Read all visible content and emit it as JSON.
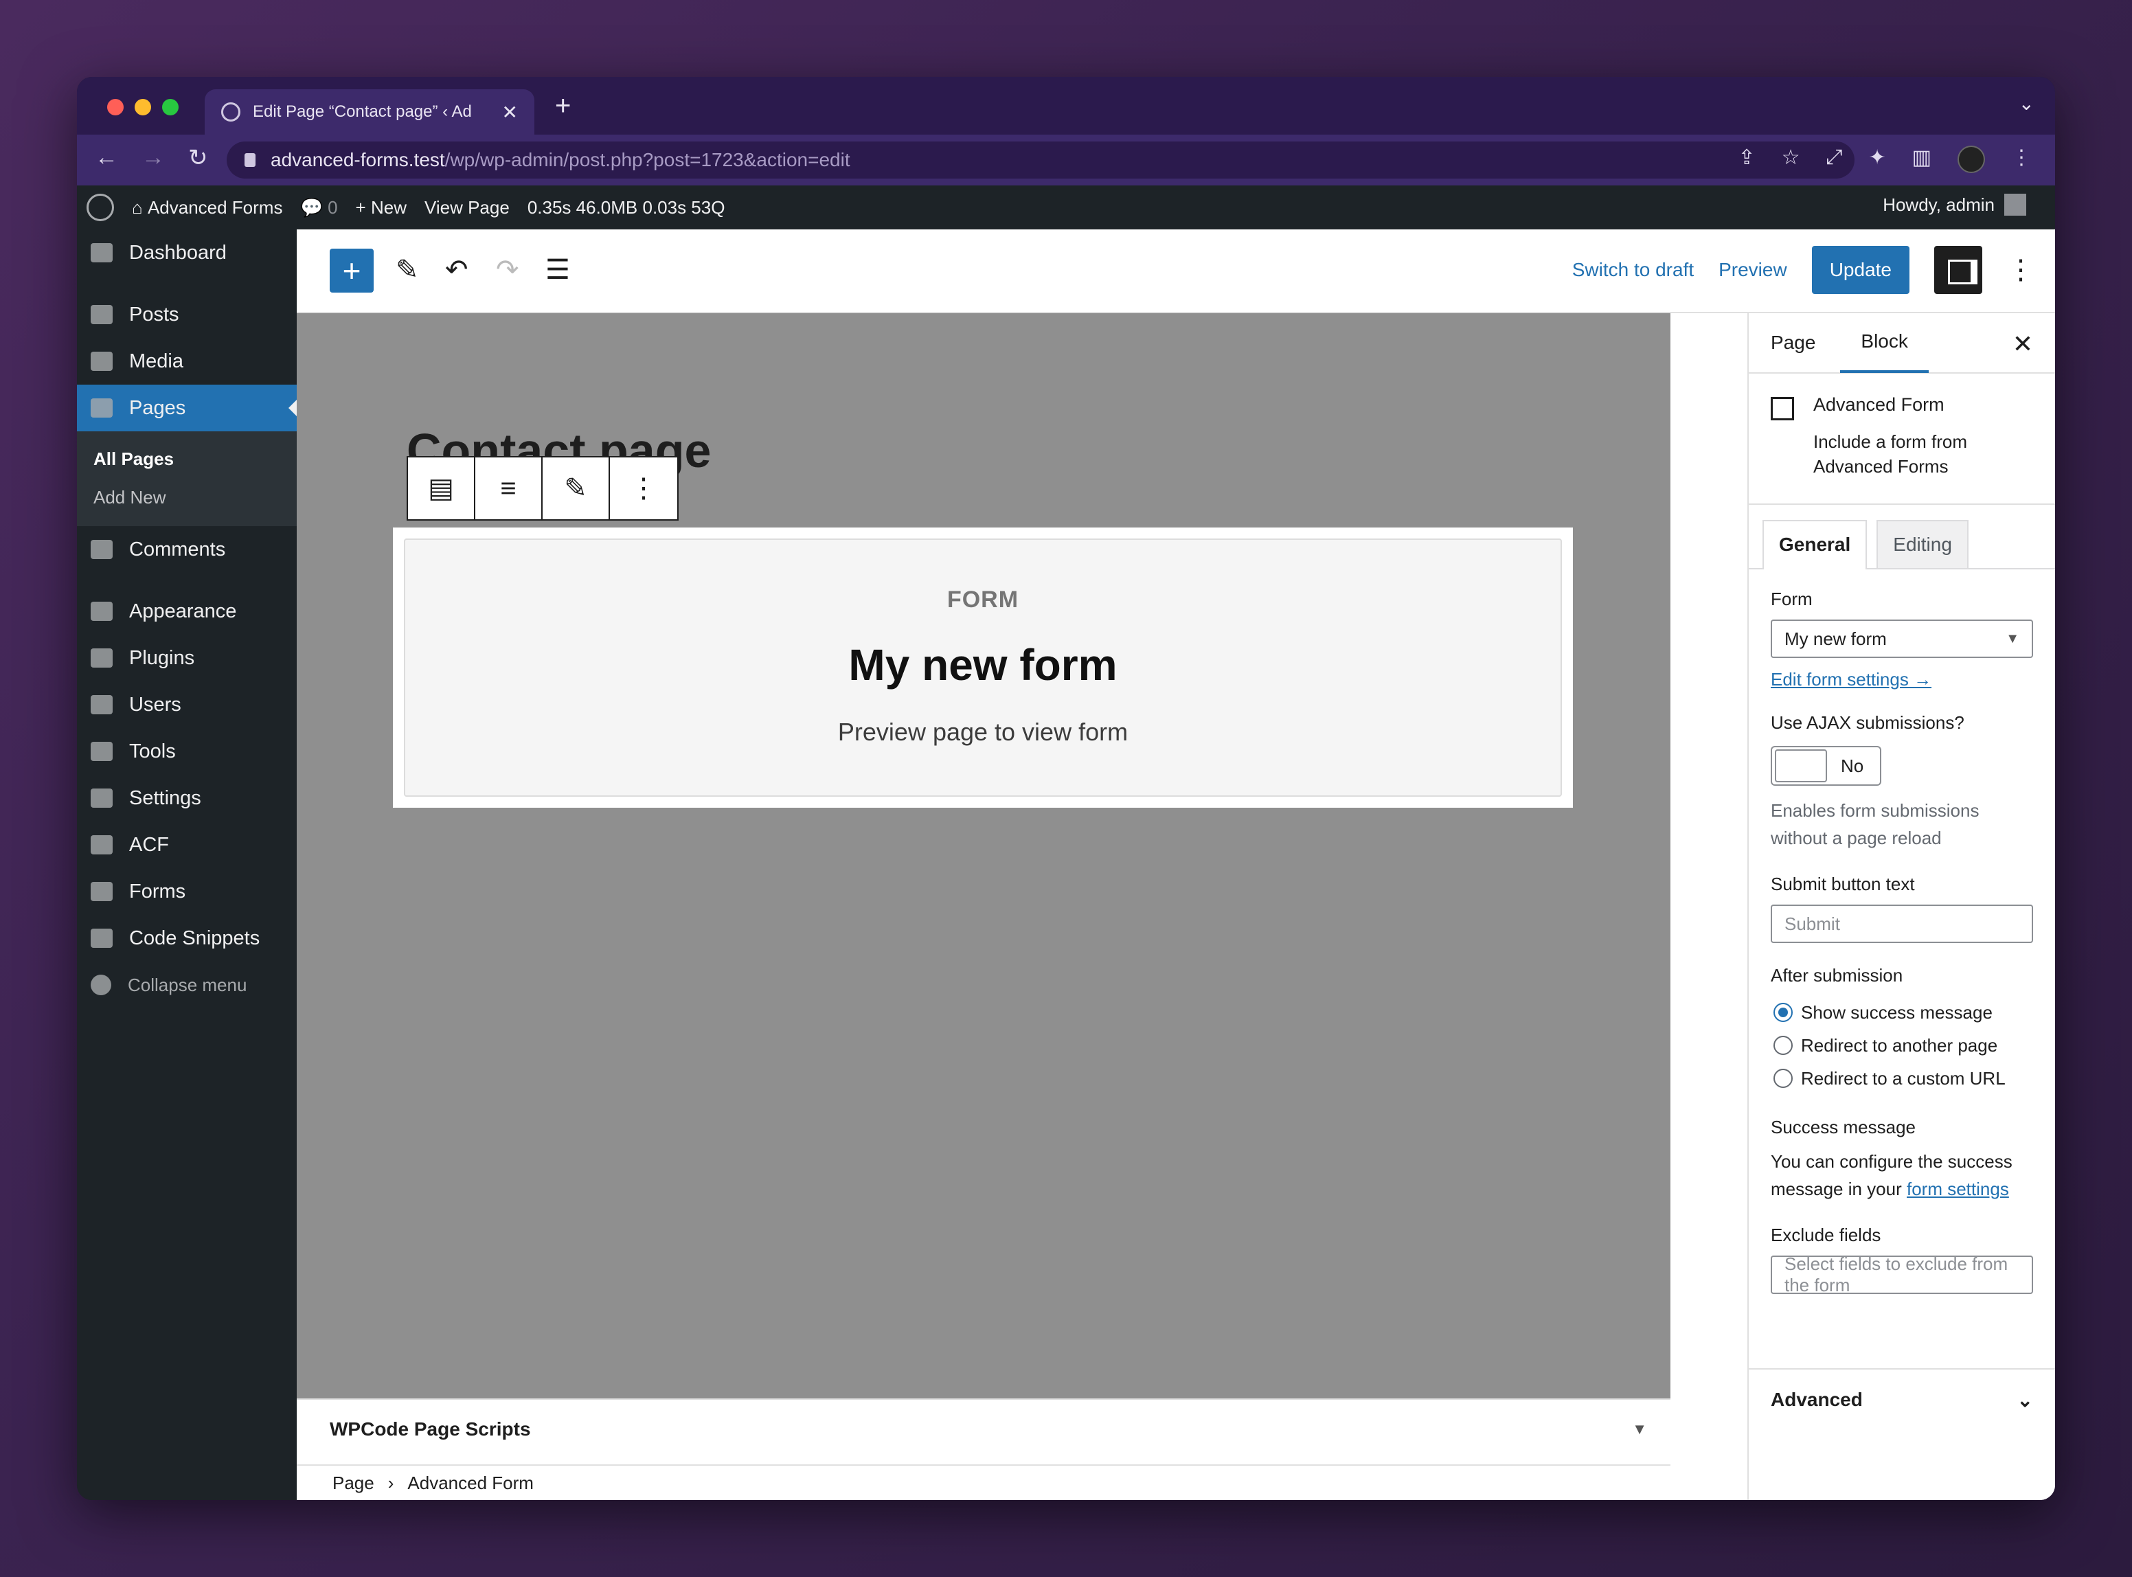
{
  "browser": {
    "tab_title": "Edit Page “Contact page” ‹ Ad",
    "url_host": "advanced-forms.test",
    "url_path": "/wp/wp-admin/post.php?post=1723&action=edit",
    "traffic_lights": [
      "#ff5f57",
      "#febc2e",
      "#28c840"
    ]
  },
  "adminbar": {
    "site": "Advanced Forms",
    "comments": "0",
    "new": "New",
    "view": "View Page",
    "stats": "0.35s  46.0MB  0.03s  53Q",
    "howdy": "Howdy, admin"
  },
  "sidebar": {
    "items": [
      {
        "label": "Dashboard"
      },
      {
        "label": "Posts"
      },
      {
        "label": "Media"
      },
      {
        "label": "Pages"
      },
      {
        "label": "Comments"
      },
      {
        "label": "Appearance"
      },
      {
        "label": "Plugins"
      },
      {
        "label": "Users"
      },
      {
        "label": "Tools"
      },
      {
        "label": "Settings"
      },
      {
        "label": "ACF"
      },
      {
        "label": "Forms"
      },
      {
        "label": "Code Snippets"
      }
    ],
    "submenu": [
      "All Pages",
      "Add New"
    ],
    "collapse": "Collapse menu"
  },
  "toolbar": {
    "switch_draft": "Switch to draft",
    "preview": "Preview",
    "update": "Update"
  },
  "canvas": {
    "page_title": "Contact page",
    "form_label": "FORM",
    "form_title": "My new form",
    "form_sub": "Preview page to view form"
  },
  "metabox": {
    "title": "WPCode Page Scripts"
  },
  "breadcrumbs": {
    "page": "Page",
    "sep": "›",
    "block": "Advanced Form"
  },
  "inspector": {
    "tab_page": "Page",
    "tab_block": "Block",
    "block_name": "Advanced Form",
    "block_desc": "Include a form from Advanced Forms",
    "tab_general": "General",
    "tab_editing": "Editing",
    "form_label": "Form",
    "form_value": "My new form",
    "edit_link": "Edit form settings →",
    "ajax_label": "Use AJAX submissions?",
    "ajax_value": "No",
    "ajax_help": "Enables form submissions without a page reload",
    "submit_label": "Submit button text",
    "submit_placeholder": "Submit",
    "after_label": "After submission",
    "after_options": [
      "Show success message",
      "Redirect to another page",
      "Redirect to a custom URL"
    ],
    "success_label": "Success message",
    "success_text": "You can configure the success message in your",
    "success_link": "form settings",
    "exclude_label": "Exclude fields",
    "exclude_placeholder": "Select fields to exclude from the form",
    "advanced": "Advanced"
  }
}
